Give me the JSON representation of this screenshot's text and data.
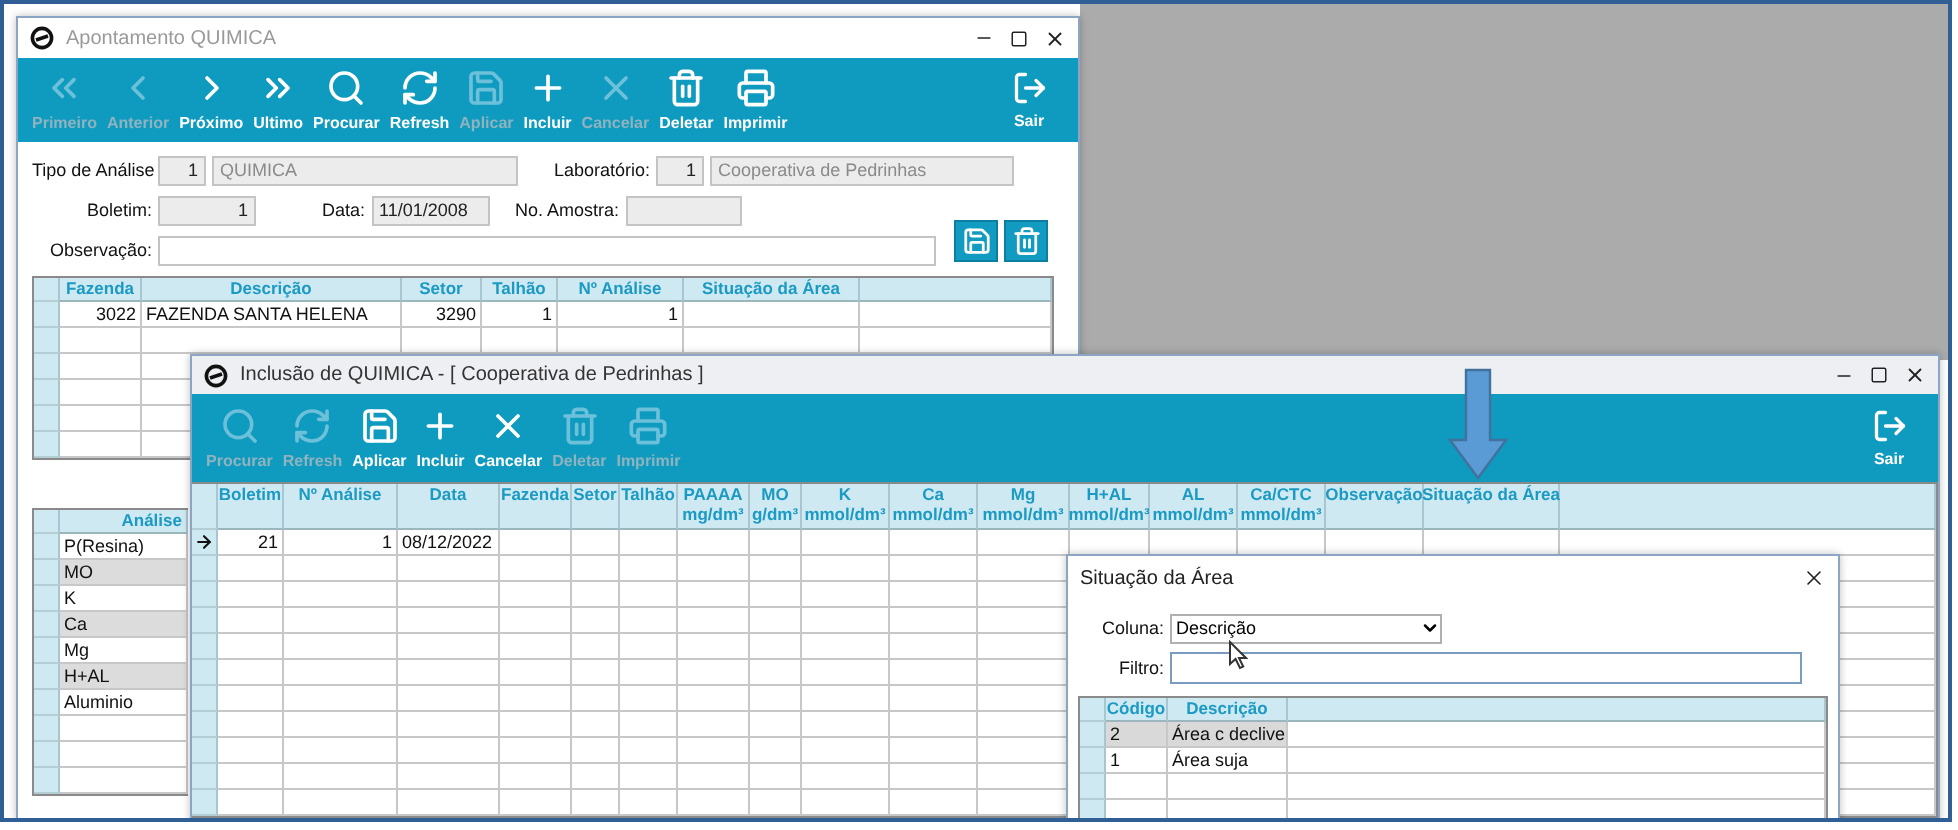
{
  "main_window": {
    "title": "Apontamento QUIMICA",
    "toolbar": [
      {
        "label": "Primeiro",
        "disabled": true
      },
      {
        "label": "Anterior",
        "disabled": true
      },
      {
        "label": "Próximo",
        "disabled": false
      },
      {
        "label": "Ultimo",
        "disabled": false
      },
      {
        "label": "Procurar",
        "disabled": false
      },
      {
        "label": "Refresh",
        "disabled": false
      },
      {
        "label": "Aplicar",
        "disabled": true
      },
      {
        "label": "Incluir",
        "disabled": false
      },
      {
        "label": "Cancelar",
        "disabled": true
      },
      {
        "label": "Deletar",
        "disabled": false
      },
      {
        "label": "Imprimir",
        "disabled": false
      }
    ],
    "exit": {
      "label": "Sair"
    },
    "form": {
      "tipo_analise": {
        "label": "Tipo de Análise",
        "code": "1",
        "name": "QUIMICA"
      },
      "laboratorio": {
        "label": "Laboratório:",
        "code": "1",
        "name": "Cooperativa de Pedrinhas"
      },
      "boletim": {
        "label": "Boletim:",
        "value": "1"
      },
      "data": {
        "label": "Data:",
        "value": "11/01/2008"
      },
      "amostra": {
        "label": "No. Amostra:"
      },
      "observacao": {
        "label": "Observação:"
      }
    },
    "farm_grid": {
      "columns": [
        "Fazenda",
        "Descrição",
        "Setor",
        "Talhão",
        "Nº Análise",
        "Situação da Área"
      ],
      "rows": [
        [
          "3022",
          "FAZENDA SANTA HELENA",
          "3290",
          "1",
          "1"
        ]
      ]
    },
    "analysis_list": {
      "column": "Análise",
      "items": [
        "P(Resina)",
        "MO",
        "K",
        "Ca",
        "Mg",
        "H+AL",
        "Aluminio"
      ]
    }
  },
  "inclusion_window": {
    "title": "Inclusão de QUIMICA - [ Cooperativa de Pedrinhas ]",
    "toolbar": [
      {
        "label": "Procurar",
        "disabled": true
      },
      {
        "label": "Refresh",
        "disabled": true
      },
      {
        "label": "Aplicar",
        "disabled": false
      },
      {
        "label": "Incluir",
        "disabled": false
      },
      {
        "label": "Cancelar",
        "disabled": false
      },
      {
        "label": "Deletar",
        "disabled": true
      },
      {
        "label": "Imprimir",
        "disabled": true
      }
    ],
    "exit": {
      "label": "Sair"
    },
    "grid": {
      "columns": [
        {
          "label": "Boletim"
        },
        {
          "label": "Nº Análise"
        },
        {
          "label": "Data"
        },
        {
          "label": "Fazenda"
        },
        {
          "label": "Setor"
        },
        {
          "label": "Talhão"
        },
        {
          "label": "PAAAA",
          "unit": "mg/dm³"
        },
        {
          "label": "MO",
          "unit": "g/dm³"
        },
        {
          "label": "K",
          "unit": "mmol/dm³"
        },
        {
          "label": "Ca",
          "unit": "mmol/dm³"
        },
        {
          "label": "Mg",
          "unit": "mmol/dm³"
        },
        {
          "label": "H+AL",
          "unit": "mmol/dm³"
        },
        {
          "label": "AL",
          "unit": "mmol/dm³"
        },
        {
          "label": "Ca/CTC",
          "unit": "mmol/dm³"
        },
        {
          "label": "Observação"
        },
        {
          "label": "Situação da Área"
        }
      ],
      "rows": [
        {
          "current": true,
          "cells": [
            "21",
            "1",
            "08/12/2022"
          ]
        }
      ]
    }
  },
  "dialog": {
    "title": "Situação da Área",
    "column_label": "Coluna:",
    "column_value": "Descrição",
    "filter_label": "Filtro:",
    "grid": {
      "columns": [
        "Código",
        "Descrição"
      ],
      "rows": [
        {
          "selected": true,
          "cells": [
            "2",
            "Área c declive"
          ]
        },
        {
          "selected": false,
          "cells": [
            "1",
            "Área suja"
          ]
        }
      ]
    }
  }
}
